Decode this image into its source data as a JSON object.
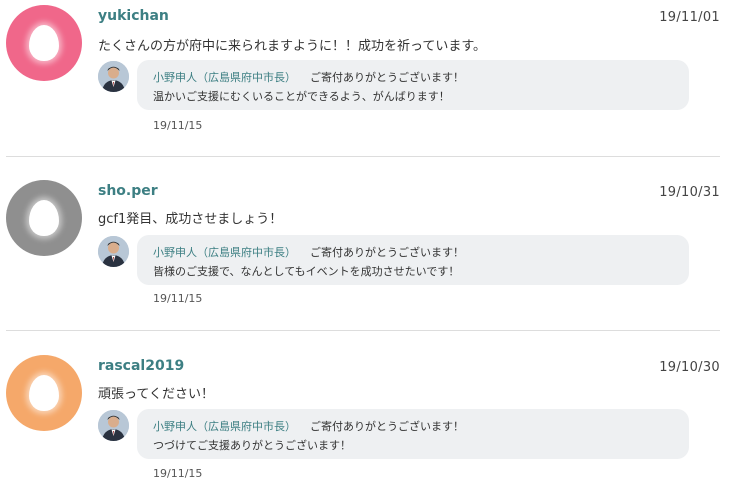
{
  "comments": [
    {
      "username": "yukichan",
      "date": "19/11/01",
      "text": "たくさんの方が府中に来られますように！！成功を祈っています。",
      "avatar_color": "#f0678a",
      "reply": {
        "author": "小野申人（広島県府中市長）",
        "line1": "ご寄付ありがとうございます！",
        "line2": "温かいご支援にむくいることができるよう、がんばります！",
        "date": "19/11/15"
      }
    },
    {
      "username": "sho.per",
      "date": "19/10/31",
      "text": "gcf1発目、成功させましょう！",
      "avatar_color": "#8f8f8f",
      "reply": {
        "author": "小野申人（広島県府中市長）",
        "line1": "ご寄付ありがとうございます！",
        "line2": "皆様のご支援で、なんとしてもイベントを成功させたいです！",
        "date": "19/11/15"
      }
    },
    {
      "username": "rascal2019",
      "date": "19/10/30",
      "text": "頑張ってください！",
      "avatar_color": "#f5a86a",
      "reply": {
        "author": "小野申人（広島県府中市長）",
        "line1": "ご寄付ありがとうございます！",
        "line2": "つづけてご支援ありがとうございます！",
        "date": "19/11/15"
      }
    }
  ]
}
